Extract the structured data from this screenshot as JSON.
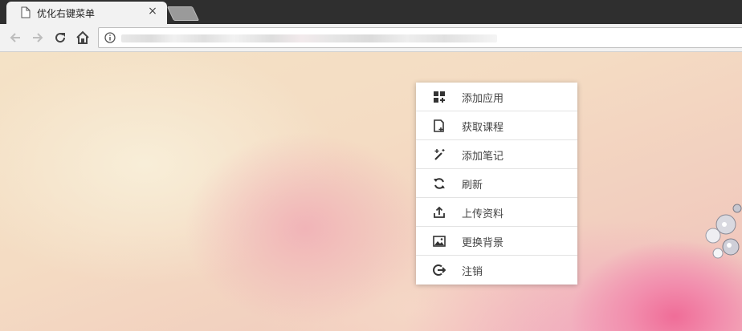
{
  "tab": {
    "title": "优化右键菜单",
    "close_glyph": "×",
    "page_icon": "page-icon"
  },
  "toolbar": {
    "icons": [
      "back-arrow-icon",
      "forward-arrow-icon",
      "reload-icon",
      "home-icon",
      "info-icon"
    ],
    "url_obscured": true
  },
  "context_menu": {
    "items": [
      {
        "label": "添加应用",
        "icon": "apps-add-icon"
      },
      {
        "label": "获取课程",
        "icon": "document-add-icon"
      },
      {
        "label": "添加笔记",
        "icon": "magic-wand-icon"
      },
      {
        "label": "刷新",
        "icon": "refresh-icon"
      },
      {
        "label": "上传资料",
        "icon": "upload-icon"
      },
      {
        "label": "更换背景",
        "icon": "image-icon"
      },
      {
        "label": "注销",
        "icon": "logout-icon"
      }
    ]
  },
  "colors": {
    "tab_strip": "#2f2f2f",
    "toolbar": "#f2f2f2",
    "menu_bg": "#ffffff",
    "menu_text": "#444444",
    "icon": "#333333"
  }
}
